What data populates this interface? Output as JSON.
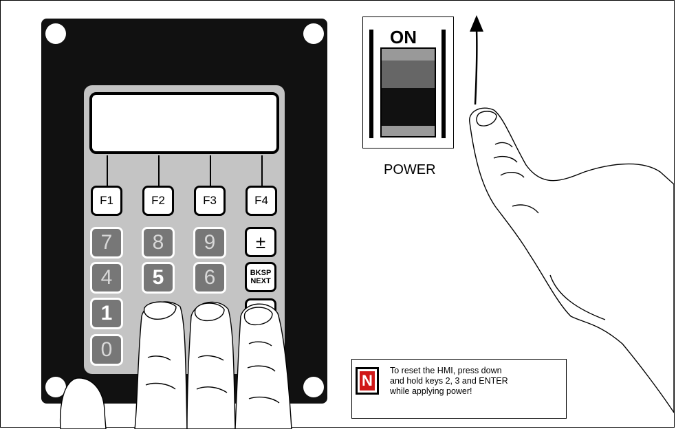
{
  "keypad": {
    "function_keys": [
      "F1",
      "F2",
      "F3",
      "F4"
    ],
    "number_keys": {
      "row1": [
        "7",
        "8",
        "9"
      ],
      "row2": [
        "4",
        "5",
        "6"
      ],
      "row3": [
        "1"
      ],
      "row4": [
        "0"
      ]
    },
    "side_keys": {
      "plus_minus": "±",
      "bksp": "BKSP",
      "next": "NEXT"
    }
  },
  "switch": {
    "on_label": "ON",
    "power_label": "POWER"
  },
  "note": {
    "badge": "N",
    "line1": "To reset the HMI, press down",
    "line2": "and hold keys 2, 3 and ENTER",
    "line3": "while applying power!"
  },
  "colors": {
    "panel": "#111111",
    "keypad_face": "#c4c4c4",
    "number_key": "#777777",
    "note_badge": "#d01818"
  }
}
